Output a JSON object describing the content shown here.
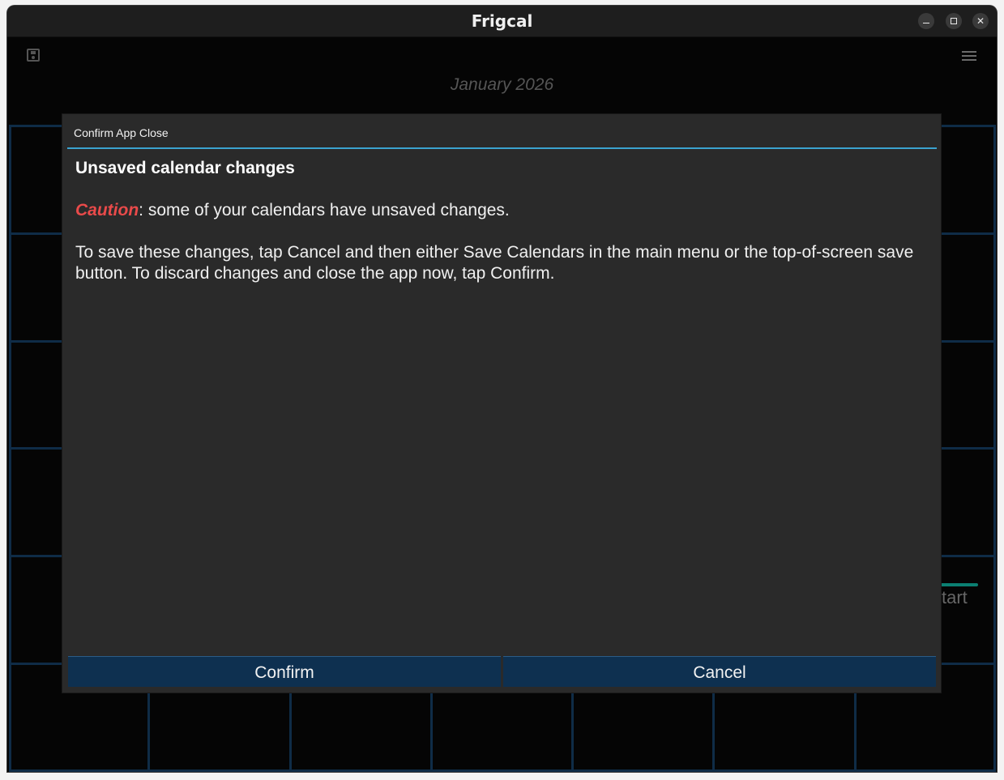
{
  "window": {
    "title": "Frigcal",
    "controls": {
      "minimize": "minimize",
      "maximize": "maximize",
      "close": "✕"
    }
  },
  "toolbar": {
    "save_icon": "save-icon",
    "menu_icon": "menu-icon"
  },
  "calendar": {
    "month_label": "January 2026",
    "partial_event_text": "start"
  },
  "dialog": {
    "title": "Confirm App Close",
    "heading": "Unsaved calendar changes",
    "caution_label": "Caution",
    "caution_text": ": some of your calendars have unsaved changes.",
    "instructions": "To save these changes, tap Cancel and then either Save Calendars in the main menu or the top-of-screen save button.  To discard changes and close the app now, tap Confirm.",
    "confirm_label": "Confirm",
    "cancel_label": "Cancel"
  },
  "colors": {
    "dialog_background": "#2a2a2a",
    "accent_rule": "#3aa3d0",
    "caution": "#e94a4a",
    "button_background": "#0e3050",
    "grid_lines": "#0f2c47"
  }
}
